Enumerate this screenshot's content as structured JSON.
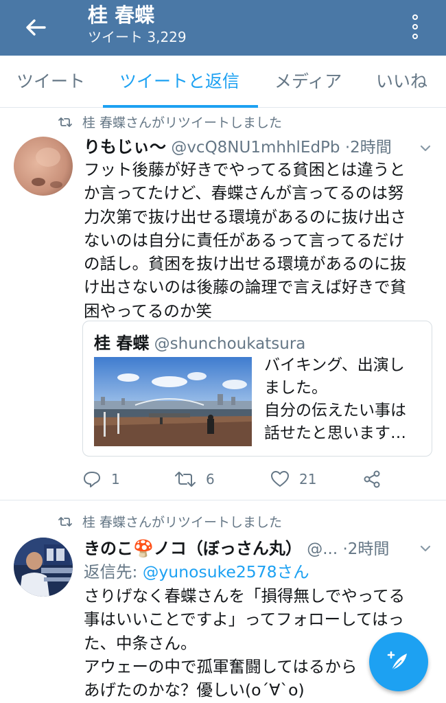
{
  "header": {
    "title": "桂 春蝶",
    "subtitle": "ツイート 3,229"
  },
  "tabs": [
    {
      "label": "ツイート"
    },
    {
      "label": "ツイートと返信"
    },
    {
      "label": "メディア"
    },
    {
      "label": "いいね"
    }
  ],
  "active_tab": "ツイートと返信",
  "tweets": [
    {
      "retweet_label": "桂 春蝶さんがリツイートしました",
      "name": "りもじぃ〜",
      "handle": "@vcQ8NU1mhhlEdPb",
      "separator": "·",
      "time": "2時間",
      "text_lines": [
        "フット後藤が好きでやってる貧困とは違うと",
        "か言ってたけど、春蝶さんが言ってるのは努",
        "力次第で抜け出せる環境があるのに抜け出さ",
        "ないのは自分に責任があるって言ってるだけ",
        "の話し。貧困を抜け出せる環境があるのに抜",
        "け出さないのは後藤の論理で言えば好きで貧",
        "困やってるのか笑"
      ],
      "quote": {
        "name": "桂 春蝶",
        "handle": "@shunchoukatsura",
        "text_lines": [
          "バイキング、出演し",
          "ました。",
          "自分の伝えたい事は",
          "話せたと思います…"
        ]
      },
      "actions": {
        "replies": "1",
        "retweets": "6",
        "likes": "21"
      }
    },
    {
      "retweet_label": "桂 春蝶さんがリツイートしました",
      "name": "きのこ🍄ノコ（ぼっさん丸）",
      "handle": "@...",
      "separator": "·",
      "time": "2時間",
      "reply_to_prefix": "返信先: ",
      "reply_to_handle": "@yunosuke2578さん",
      "text_lines": [
        "さりげなく春蝶さんを「損得無しでやってる",
        "事はいいことですよ」ってフォローしてはっ",
        "た、中条さん。",
        "アウェーの中で孤軍奮闘してはるから",
        "あげたのかな？優しい(o´∀`o)"
      ]
    }
  ],
  "colors": {
    "appbar": "#4a78a6",
    "accent": "#1da1f2",
    "secondary_text": "#657786"
  }
}
